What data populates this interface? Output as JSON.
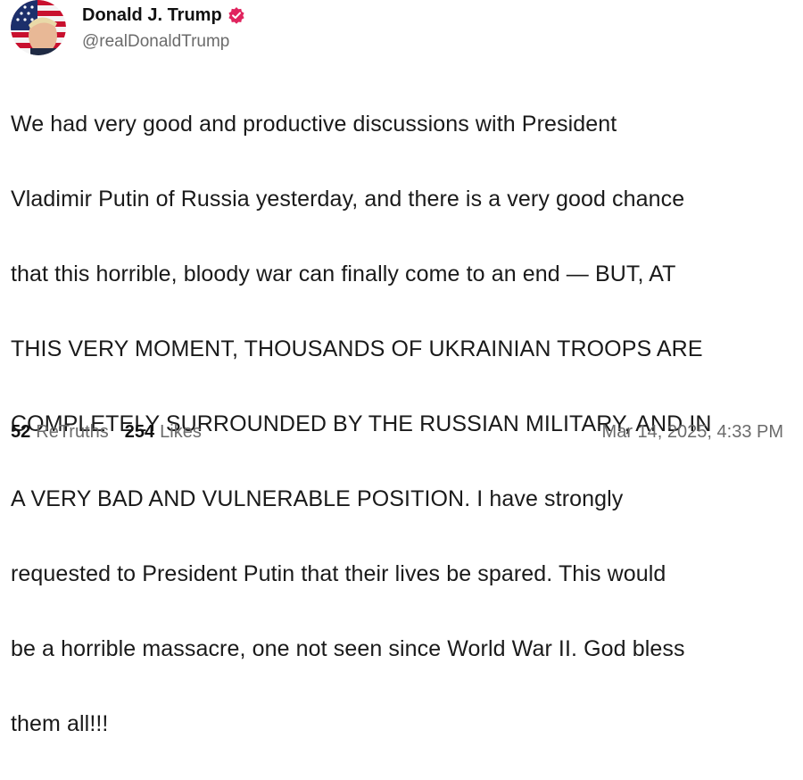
{
  "post": {
    "author": {
      "display_name": "Donald J. Trump",
      "handle": "@realDonaldTrump",
      "verified_icon": "verified-badge-icon",
      "badge_color": "#e0245e"
    },
    "text_lines": [
      "We had very good and productive discussions with President",
      "Vladimir Putin of Russia yesterday, and there is a very good chance",
      "that this horrible, bloody war can finally come to an end — BUT, AT",
      "THIS VERY MOMENT, THOUSANDS OF UKRAINIAN TROOPS ARE",
      "COMPLETELY SURROUNDED BY THE RUSSIAN MILITARY, AND IN",
      "A VERY BAD AND VULNERABLE POSITION. I have strongly",
      "requested to President Putin that their lives be spared. This would",
      "be a horrible massacre, one not seen since World War II. God bless",
      "them all!!!"
    ],
    "stats": {
      "retruths_count": "52",
      "retruths_label": "ReTruths",
      "likes_count": "254",
      "likes_label": "Likes"
    },
    "timestamp": "Mar 14, 2025, 4:33 PM"
  }
}
